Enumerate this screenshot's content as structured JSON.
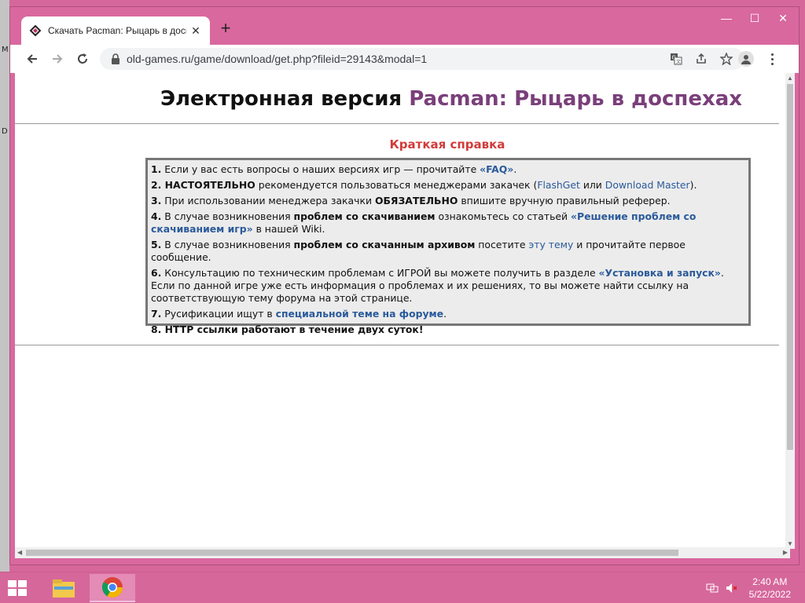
{
  "desktop": {
    "left_letters": [
      "M",
      "D"
    ]
  },
  "browser": {
    "tab": {
      "title": "Скачать Pacman: Рыцарь в доспехах",
      "close": "✕"
    },
    "new_tab": "+",
    "window_controls": {
      "minimize": "—",
      "maximize": "☐",
      "close": "✕"
    },
    "address": "old-games.ru/game/download/get.php?fileid=29143&modal=1"
  },
  "page": {
    "title_prefix": "Электронная версия ",
    "title_game": "Pacman: Рыцарь в доспехах",
    "section_title": "Краткая справка",
    "items": [
      {
        "n": "1.",
        "t1": " Если у вас есть вопросы о наших версиях игр — прочитайте ",
        "link": "«FAQ»",
        "t2": "."
      },
      {
        "n": "2.",
        "bold": " НАСТОЯТЕЛЬНО",
        "t1": " рекомендуется пользоваться менеджерами закачек (",
        "link1": "FlashGet",
        "mid": " или ",
        "link2": "Download Master",
        "t2": ")."
      },
      {
        "n": "3.",
        "t1": " При использовании менеджера закачки ",
        "bold": "ОБЯЗАТЕЛЬНО",
        "t2": " впишите вручную правильный реферер."
      },
      {
        "n": "4.",
        "t1": " В случае возникновения ",
        "bold": "проблем со скачиванием",
        "t2": " ознакомьтесь со статьей ",
        "link": "«Решение проблем со скачиванием игр»",
        "t3": " в нашей Wiki."
      },
      {
        "n": "5.",
        "t1": " В случае возникновения ",
        "bold": "проблем со скачанным архивом",
        "t2": " посетите ",
        "link": "эту тему",
        "t3": " и прочитайте первое сообщение."
      },
      {
        "n": "6.",
        "t1": " Консультацию по техническим проблемам с ИГРОЙ вы можете получить в разделе ",
        "link": "«Установка и запуск»",
        "t2": ". Если по данной игре уже есть информация о проблемах и их решениях, то вы можете найти ссылку на соответствующую тему форума на этой странице."
      },
      {
        "n": "7.",
        "t1": " Русификации ищут в ",
        "link": "специальной теме на форуме",
        "t2": "."
      },
      {
        "n": "8.",
        "bold": " HTTP ссылки работают в течение двух суток!"
      }
    ]
  },
  "taskbar": {
    "time": "2:40 AM",
    "date": "5/22/2022"
  }
}
